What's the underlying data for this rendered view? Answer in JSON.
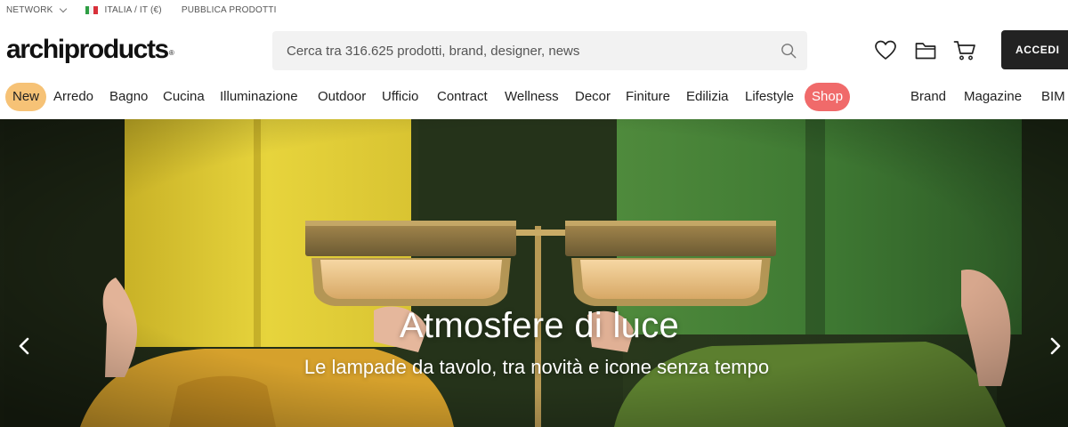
{
  "topbar": {
    "network": "NETWORK",
    "locale": "ITALIA / IT (€)",
    "publish": "PUBBLICA PRODOTTI"
  },
  "header": {
    "logo": "archiproducts",
    "logo_mark": "®",
    "search_placeholder": "Cerca tra 316.625 prodotti, brand, designer, news",
    "icons": [
      "heart-icon",
      "folder-icon",
      "cart-icon",
      "search-icon"
    ],
    "login_label": "ACCEDI"
  },
  "nav": {
    "new": "New",
    "arredo": "Arredo",
    "bagno": "Bagno",
    "cucina": "Cucina",
    "illuminazione": "Illuminazione",
    "outdoor": "Outdoor",
    "ufficio": "Ufficio",
    "contract": "Contract",
    "wellness": "Wellness",
    "decor": "Decor",
    "finiture": "Finiture",
    "edilizia": "Edilizia",
    "lifestyle": "Lifestyle",
    "shop": "Shop",
    "brand": "Brand",
    "magazine": "Magazine",
    "bim": "BIM"
  },
  "hero": {
    "title": "Atmosfere di luce",
    "subtitle": "Le lampade da tavolo, tra novità e icone senza tempo"
  },
  "colors": {
    "new_pill": "#f6c276",
    "shop_pill": "#f06a6a",
    "login_button": "#222222",
    "search_bg": "#f2f2f2"
  }
}
